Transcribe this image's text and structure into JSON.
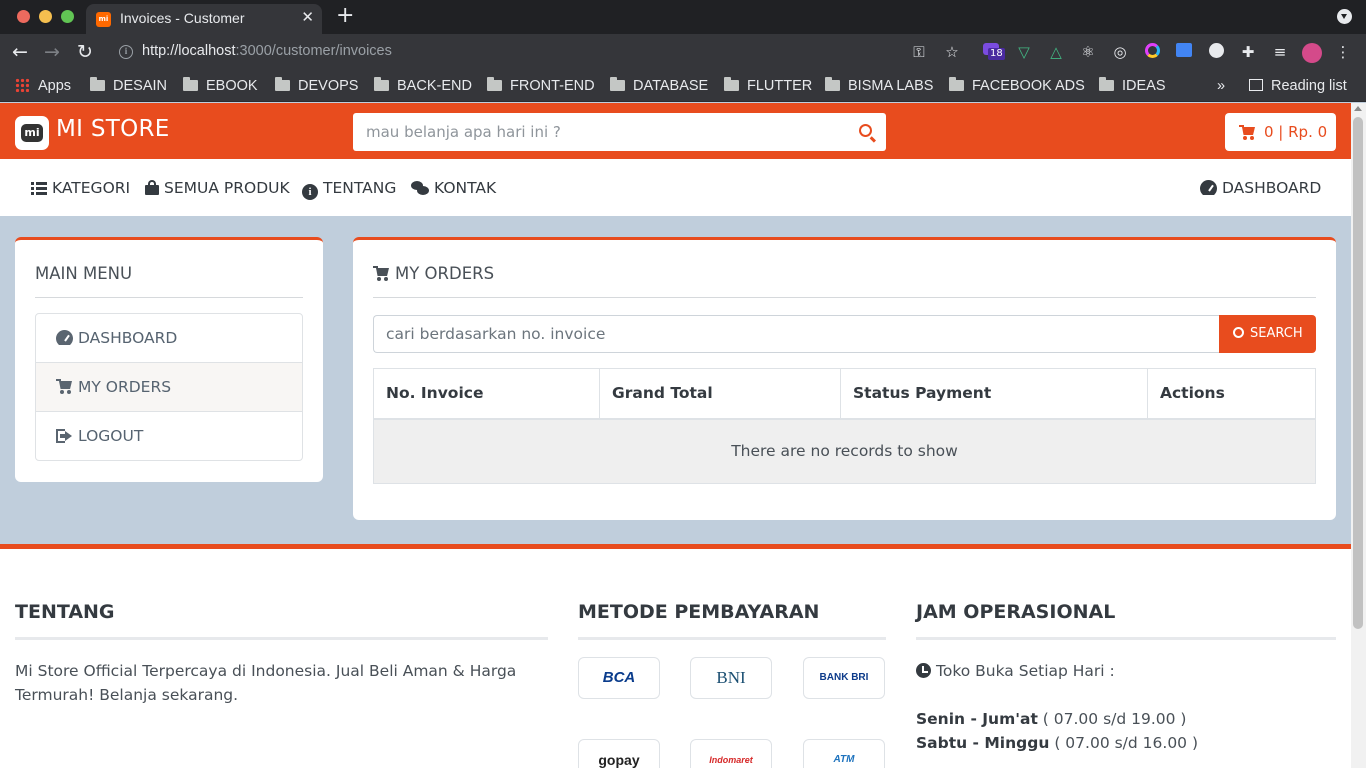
{
  "browser": {
    "tab_title": "Invoices - Customer",
    "tab_favicon_text": "mi",
    "url_host": "http://localhost",
    "url_rest": ":3000/customer/invoices",
    "extension_badge": "18",
    "bookmarks": [
      {
        "label": "Apps",
        "icon": "apps-grid-icon"
      },
      {
        "label": "DESAIN",
        "icon": "folder-icon"
      },
      {
        "label": "EBOOK",
        "icon": "folder-icon"
      },
      {
        "label": "DEVOPS",
        "icon": "folder-icon"
      },
      {
        "label": "BACK-END",
        "icon": "folder-icon"
      },
      {
        "label": "FRONT-END",
        "icon": "folder-icon"
      },
      {
        "label": "DATABASE",
        "icon": "folder-icon"
      },
      {
        "label": "FLUTTER",
        "icon": "folder-icon"
      },
      {
        "label": "BISMA LABS",
        "icon": "folder-icon"
      },
      {
        "label": "FACEBOOK ADS",
        "icon": "folder-icon"
      },
      {
        "label": "IDEAS",
        "icon": "folder-icon"
      }
    ],
    "overflow_label": "»",
    "reading_list": "Reading list"
  },
  "header": {
    "logo_text": "mi",
    "brand": "MI STORE",
    "search_placeholder": "mau belanja apa hari ini ?",
    "cart_summary": "0 | Rp. 0",
    "accent_color": "#e84c1e"
  },
  "nav": {
    "kategori": "KATEGORI",
    "semua_produk": "SEMUA PRODUK",
    "tentang": "TENTANG",
    "kontak": "KONTAK",
    "dashboard": "DASHBOARD"
  },
  "sidebar": {
    "title": "MAIN MENU",
    "items": [
      {
        "label": "DASHBOARD",
        "icon": "gauge-icon"
      },
      {
        "label": "MY ORDERS",
        "icon": "cart-icon"
      },
      {
        "label": "LOGOUT",
        "icon": "logout-icon"
      }
    ]
  },
  "orders": {
    "title": "MY ORDERS",
    "search_placeholder": "cari berdasarkan no. invoice",
    "search_button": "SEARCH",
    "columns": [
      "No. Invoice",
      "Grand Total",
      "Status Payment",
      "Actions"
    ],
    "empty_text": "There are no records to show"
  },
  "footer": {
    "tentang_title": "TENTANG",
    "tentang_text": "Mi Store Official Terpercaya di Indonesia. Jual Beli Aman & Harga Termurah! Belanja sekarang.",
    "payment_title": "METODE PEMBAYARAN",
    "payments": [
      "BCA",
      "BNI",
      "BANK BRI",
      "gopay",
      "Indomaret",
      "ATM"
    ],
    "hours_title": "JAM OPERASIONAL",
    "hours_intro": "Toko Buka Setiap Hari :",
    "hours": [
      {
        "days": "Senin - Jum'at",
        "time": "( 07.00 s/d 19.00 )"
      },
      {
        "days": "Sabtu - Minggu",
        "time": "( 07.00 s/d 16.00 )"
      }
    ]
  }
}
